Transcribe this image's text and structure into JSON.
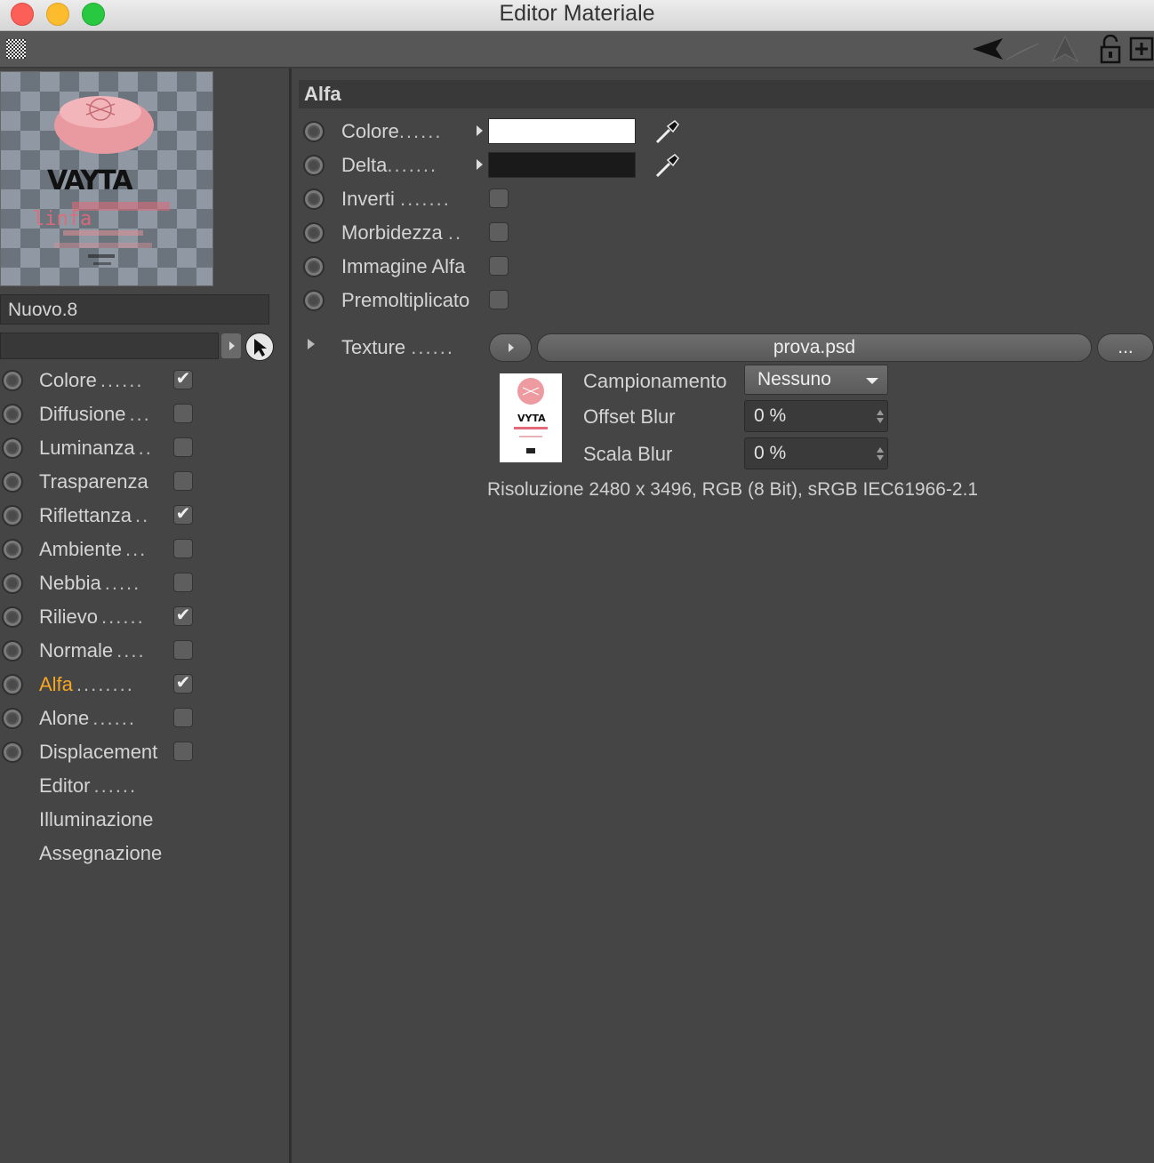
{
  "window": {
    "title": "Editor Materiale"
  },
  "material": {
    "name": "Nuovo.8",
    "search_value": ""
  },
  "channels": [
    {
      "label": "Colore",
      "dots": "......",
      "checked": "✔",
      "active": false,
      "has_radio": true,
      "has_check": true
    },
    {
      "label": "Diffusione",
      "dots": "...",
      "checked": "",
      "active": false,
      "has_radio": true,
      "has_check": true
    },
    {
      "label": "Luminanza",
      "dots": "..",
      "checked": "",
      "active": false,
      "has_radio": true,
      "has_check": true
    },
    {
      "label": "Trasparenza",
      "dots": "",
      "checked": "",
      "active": false,
      "has_radio": true,
      "has_check": true
    },
    {
      "label": "Riflettanza",
      "dots": "..",
      "checked": "✔",
      "active": false,
      "has_radio": true,
      "has_check": true
    },
    {
      "label": "Ambiente",
      "dots": "...",
      "checked": "",
      "active": false,
      "has_radio": true,
      "has_check": true
    },
    {
      "label": "Nebbia",
      "dots": ".....",
      "checked": "",
      "active": false,
      "has_radio": true,
      "has_check": true
    },
    {
      "label": "Rilievo",
      "dots": "......",
      "checked": "✔",
      "active": false,
      "has_radio": true,
      "has_check": true
    },
    {
      "label": "Normale",
      "dots": "....",
      "checked": "",
      "active": false,
      "has_radio": true,
      "has_check": true
    },
    {
      "label": "Alfa",
      "dots": "........",
      "checked": "✔",
      "active": true,
      "has_radio": true,
      "has_check": true
    },
    {
      "label": "Alone",
      "dots": "......",
      "checked": "",
      "active": false,
      "has_radio": true,
      "has_check": true
    },
    {
      "label": "Displacement",
      "dots": "",
      "checked": "",
      "active": false,
      "has_radio": true,
      "has_check": true
    },
    {
      "label": "Editor",
      "dots": "......",
      "checked": "",
      "active": false,
      "has_radio": false,
      "has_check": false
    },
    {
      "label": "Illuminazione",
      "dots": "",
      "checked": "",
      "active": false,
      "has_radio": false,
      "has_check": false
    },
    {
      "label": "Assegnazione",
      "dots": "",
      "checked": "",
      "active": false,
      "has_radio": false,
      "has_check": false
    }
  ],
  "alpha": {
    "section_title": "Alfa",
    "colore_label": "Colore",
    "colore_dots": "......",
    "colore_value": "#ffffff",
    "delta_label": "Delta",
    "delta_dots": ".......",
    "delta_value": "#1a1a1a",
    "inverti_label": "Inverti",
    "inverti_dots": ".......",
    "morbidezza_label": "Morbidezza",
    "morbidezza_dots": "..",
    "immagine_label": "Immagine Alfa",
    "premolt_label": "Premoltiplicato",
    "texture_label": "Texture",
    "texture_dots": "......",
    "texture_file": "prova.psd",
    "browse_label": "...",
    "campionamento_label": "Campionamento",
    "campionamento_value": "Nessuno",
    "offset_label": "Offset Blur",
    "offset_value": "0 %",
    "scala_label": "Scala Blur",
    "scala_value": "0 %",
    "resolution": "Risoluzione 2480 x 3496, RGB (8 Bit), sRGB IEC61966-2.1"
  },
  "preview": {
    "logo_text": "VAYTA",
    "reflect_text": "linfa",
    "thumb_logo": "VYTA"
  },
  "colors": {
    "accent": "#f6a623",
    "panel": "#454545"
  }
}
